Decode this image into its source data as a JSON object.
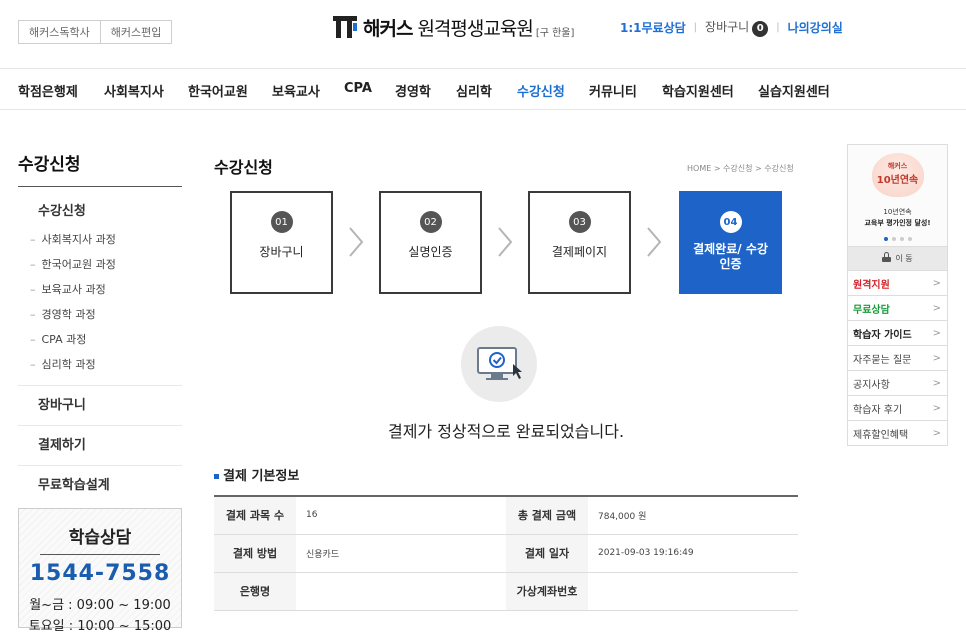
{
  "header": {
    "site_tabs": [
      "해커스독학사",
      "해커스편입"
    ],
    "logo_brand": "해커스",
    "logo_sub": "원격평생교육원",
    "logo_note": "[구 한울]",
    "consult_link": "1:1무료상담",
    "cart_label": "장바구니",
    "cart_count": "0",
    "myroom_link": "나의강의실",
    "accent_color": "#1e6fd4"
  },
  "nav": {
    "items": [
      "학점은행제",
      "사회복지사",
      "한국어교원",
      "보육교사",
      "CPA",
      "경영학",
      "심리학",
      "수강신청",
      "커뮤니티",
      "학습지원센터",
      "실습지원센터"
    ],
    "active": "수강신청"
  },
  "sidebar": {
    "title": "수강신청",
    "group_head": "수강신청",
    "sub_items": [
      "사회복지사 과정",
      "한국어교원 과정",
      "보육교사 과정",
      "경영학 과정",
      "CPA 과정",
      "심리학 과정"
    ],
    "links": [
      "장바구니",
      "결제하기",
      "무료학습설계"
    ]
  },
  "consult_box": {
    "title": "학습상담",
    "phone": "1544-7558",
    "hours_weekday": "월~금 : 09:00 ~ 19:00",
    "hours_weekend": "토요일 : 10:00 ~ 15:00"
  },
  "main": {
    "title": "수강신청",
    "breadcrumb": "HOME > 수강신청 > 수강신청",
    "steps": [
      {
        "num": "01",
        "label": "장바구니"
      },
      {
        "num": "02",
        "label": "실명인증"
      },
      {
        "num": "03",
        "label": "결제페이지"
      },
      {
        "num": "04",
        "label": "결제완료/ 수강인증"
      }
    ],
    "active_step": "04",
    "complete_message": "결제가 정상적으로 완료되었습니다.",
    "info_title": "결제 기본정보",
    "table": {
      "rows": [
        [
          {
            "label": "결제 과목 수",
            "value": "16"
          },
          {
            "label": "총 결제 금액",
            "value": "784,000 원"
          }
        ],
        [
          {
            "label": "결제 방법",
            "value": "신용카드"
          },
          {
            "label": "결제 일자",
            "value": "2021-09-03 19:16:49"
          }
        ],
        [
          {
            "label": "은행명",
            "value": ""
          },
          {
            "label": "가상계좌번호",
            "value": ""
          }
        ]
      ]
    }
  },
  "quick_menu": {
    "banner": {
      "brand": "해커스",
      "years": "10년연속",
      "line1": "10년연속",
      "line2": "교육부 평가인정 달성!"
    },
    "move_label": "이 동",
    "items": [
      {
        "label": "원격지원",
        "style": "red"
      },
      {
        "label": "무료상담",
        "style": "green"
      },
      {
        "label": "학습자 가이드",
        "style": "dark"
      },
      {
        "label": "자주묻는 질문",
        "style": "plain"
      },
      {
        "label": "공지사항",
        "style": "plain"
      },
      {
        "label": "학습자 후기",
        "style": "plain"
      },
      {
        "label": "제휴할인혜택",
        "style": "plain"
      }
    ],
    "arrow": ">"
  }
}
